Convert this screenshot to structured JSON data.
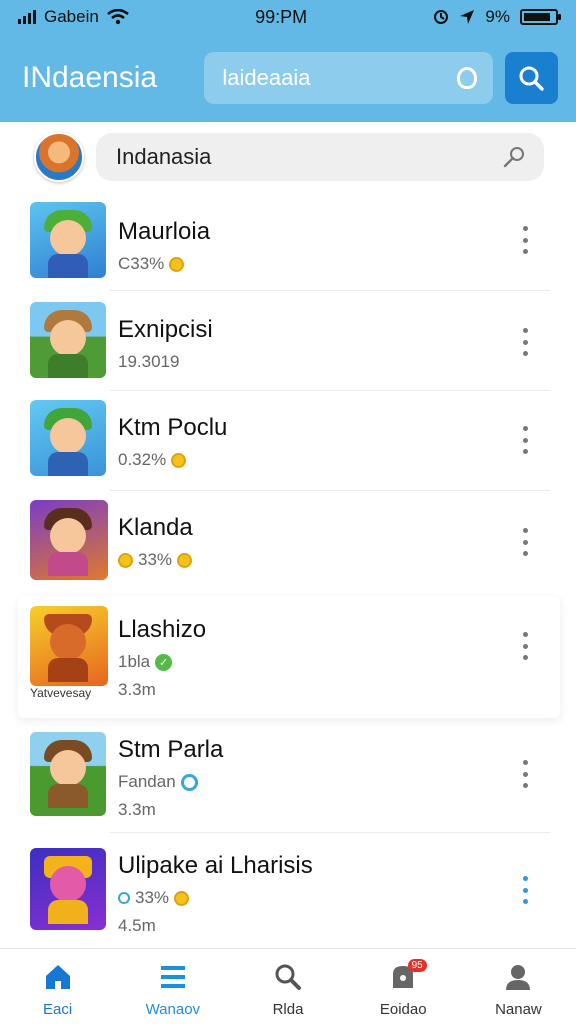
{
  "status_bar": {
    "carrier": "Gabein",
    "time": "99:PM",
    "battery": "9%"
  },
  "header": {
    "title": "INdaensia",
    "search_value": "laideaaia"
  },
  "search_bar": {
    "value": "Indanasia"
  },
  "games": [
    {
      "title": "Maurloia",
      "line1": "C33%",
      "line1_icon": "coin-icon"
    },
    {
      "title": "Exnipcisi",
      "line1": "19.3019"
    },
    {
      "title": "Ktm Poclu",
      "line1": "0.32%",
      "line1_icon": "coin-icon"
    },
    {
      "title": "Klanda",
      "line1": "33%",
      "line1_icon": "coin-icon",
      "line1_lead_icon": "coin-icon"
    },
    {
      "title": "Llashizo",
      "line1": "1bla",
      "line1_icon": "check-icon",
      "line2": "3.3m",
      "caption": "Yatvevesay"
    },
    {
      "title": "Stm Parla",
      "line1": "Fandan",
      "line1_icon": "info-ring-icon",
      "line2": "3.3m"
    },
    {
      "title": "Ulipake ai Lharisis",
      "line1": "33%",
      "line1_icon": "coin-icon",
      "line1_lead_icon": "blue-icon",
      "line2": "4.5m"
    }
  ],
  "bottom_nav": [
    {
      "label": "Eaci",
      "icon": "home-icon",
      "active": true
    },
    {
      "label": "Wanaov",
      "icon": "list-icon",
      "active": true
    },
    {
      "label": "Rlda",
      "icon": "search-icon",
      "active": false
    },
    {
      "label": "Eoidao",
      "icon": "notification-icon",
      "active": false,
      "badge": "95"
    },
    {
      "label": "Nanaw",
      "icon": "profile-icon",
      "active": false
    }
  ],
  "colors": {
    "header": "#63b9e6",
    "accent": "#1877d2",
    "search_button": "#1b7fd0"
  }
}
